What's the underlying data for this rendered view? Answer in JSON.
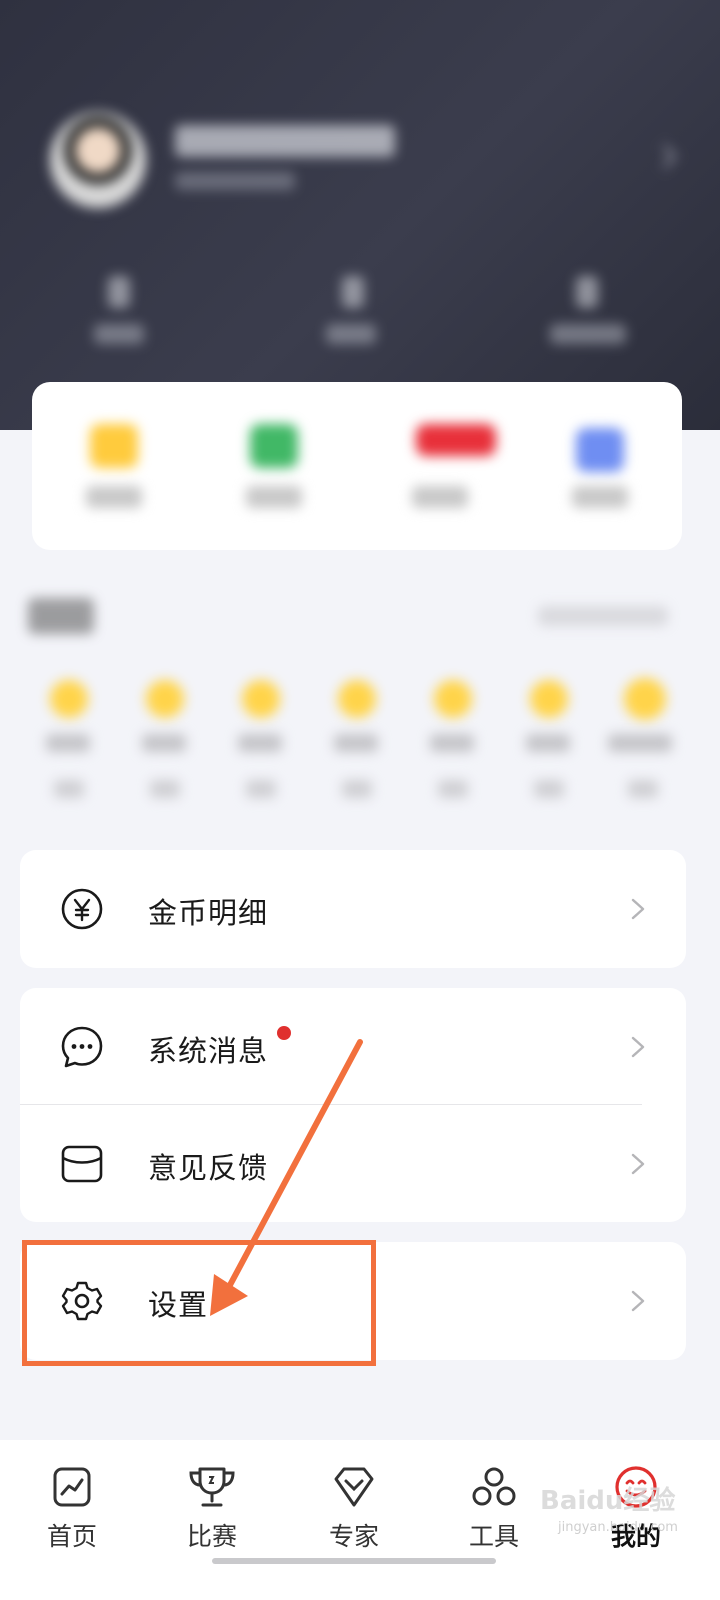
{
  "menu": {
    "coin_detail": "金币明细",
    "system_messages": "系统消息",
    "feedback": "意见反馈",
    "settings": "设置"
  },
  "tabs": [
    {
      "label": "首页",
      "icon": "home-chart-icon"
    },
    {
      "label": "比赛",
      "icon": "trophy-icon"
    },
    {
      "label": "专家",
      "icon": "diamond-icon"
    },
    {
      "label": "工具",
      "icon": "tools-icon"
    },
    {
      "label": "我的",
      "icon": "smile-face-icon",
      "active": true
    }
  ],
  "watermark": {
    "brand": "Baidu经验",
    "url": "jingyan.baidu.com"
  },
  "colors": {
    "highlight": "#f2703d",
    "notification_dot": "#e0302e",
    "active_tab": "#e0302e"
  }
}
